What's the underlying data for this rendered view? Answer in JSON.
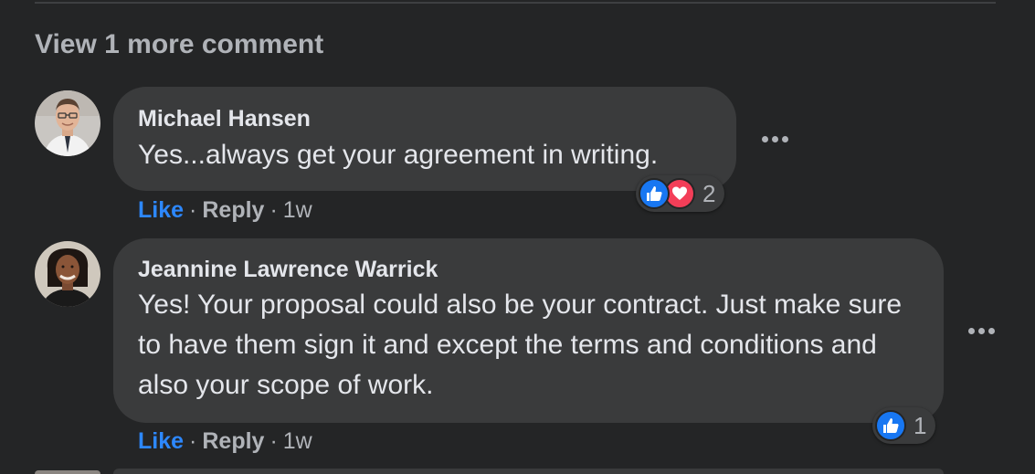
{
  "view_more": "View 1 more comment",
  "comments": [
    {
      "author": "Michael Hansen",
      "text": "Yes...always get your agreement in writing.",
      "actions": {
        "like": "Like",
        "reply": "Reply",
        "time": "1w",
        "separator": "·"
      },
      "reactions": {
        "icons": [
          "like-icon",
          "love-icon"
        ],
        "count": "2"
      }
    },
    {
      "author": "Jeannine Lawrence Warrick",
      "text": "Yes! Your proposal could also be your contract. Just make sure to have them sign it and except the terms and conditions and also your scope of work.",
      "actions": {
        "like": "Like",
        "reply": "Reply",
        "time": "1w",
        "separator": "·"
      },
      "reactions": {
        "icons": [
          "like-icon"
        ],
        "count": "1"
      }
    }
  ],
  "colors": {
    "background": "#242526",
    "bubble": "#3a3b3c",
    "like_blue": "#2d88ff",
    "love_red": "#f33e58",
    "secondary_text": "#b0b3b8"
  }
}
